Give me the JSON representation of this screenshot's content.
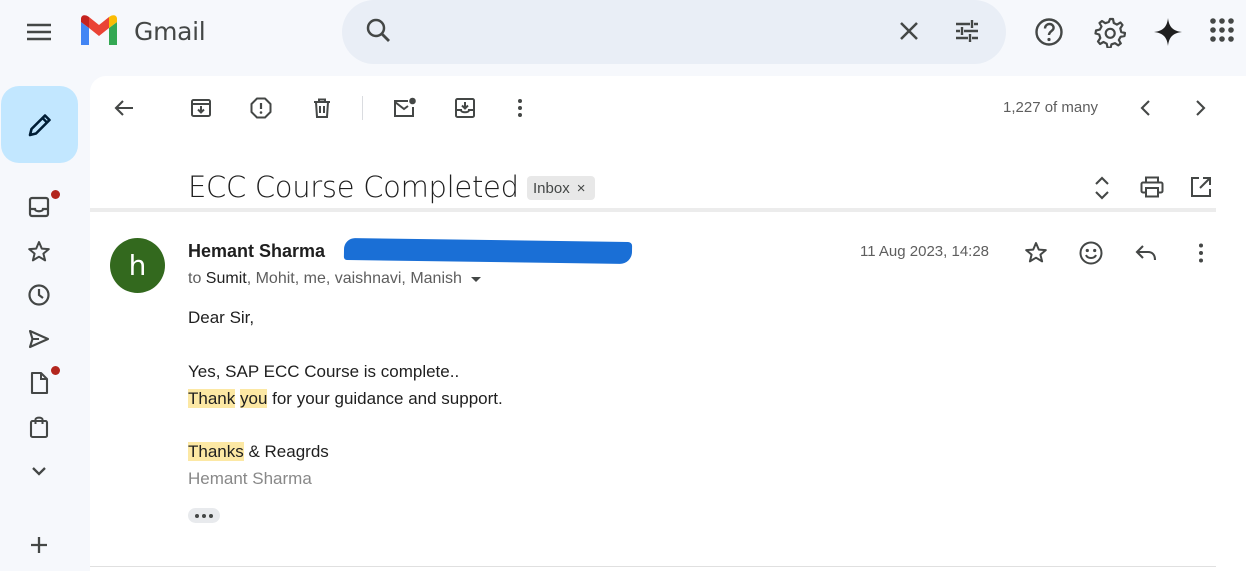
{
  "app": {
    "name": "Gmail"
  },
  "search": {
    "placeholder": ""
  },
  "toolbar": {
    "pager_text": "1,227 of many"
  },
  "email": {
    "subject": "ECC Course Completed",
    "label": "Inbox",
    "label_remove": "×",
    "sender_name": "Hemant Sharma",
    "avatar_letter": "h",
    "to_prefix": "to",
    "to_first": "Sumit",
    "to_rest": ", Mohit, me, vaishnavi, Manish",
    "date": "11 Aug 2023, 14:28",
    "greeting": "Dear Sir,",
    "line1": "Yes, SAP ECC Course is complete..",
    "line2_hl1": "Thank",
    "line2_sp": " ",
    "line2_hl2": "you",
    "line2_rest": " for your guidance and support.",
    "sign_hl": "Thanks",
    "sign_rest": " & Reagrds",
    "signature_name": "Hemant Sharma"
  },
  "colors": {
    "compose_bg": "#c2e7ff",
    "avatar_bg": "#33691e",
    "highlight": "#fce8a4",
    "notification_dot": "#b3261e",
    "redaction": "#1a6fd6"
  }
}
